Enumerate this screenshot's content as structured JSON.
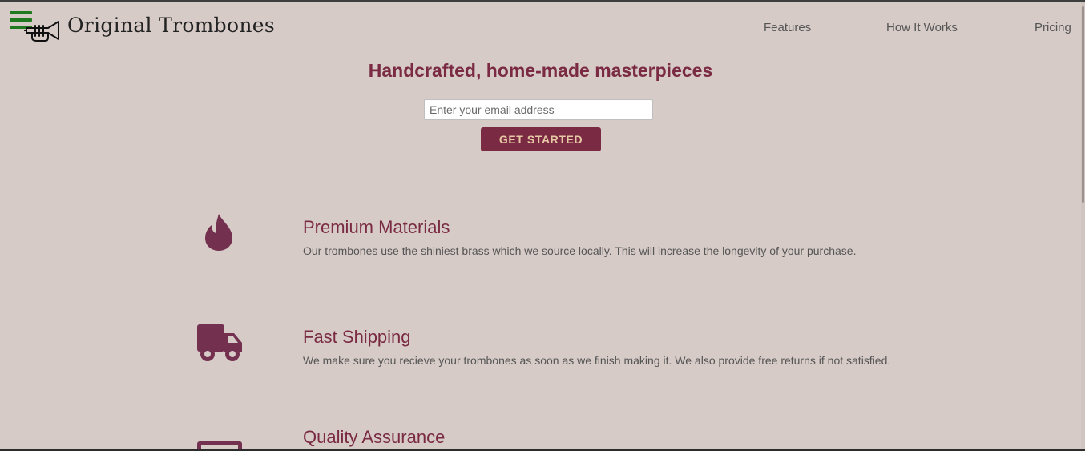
{
  "header": {
    "brand": "Original Trombones",
    "nav": [
      {
        "label": "Features"
      },
      {
        "label": "How It Works"
      },
      {
        "label": "Pricing"
      }
    ]
  },
  "hero": {
    "title": "Handcrafted, home-made masterpieces",
    "email_placeholder": "Enter your email address",
    "cta_label": "GET STARTED"
  },
  "features": [
    {
      "icon": "fire-icon",
      "title": "Premium Materials",
      "description": "Our trombones use the shiniest brass which we source locally. This will increase the longevity of your purchase."
    },
    {
      "icon": "truck-icon",
      "title": "Fast Shipping",
      "description": "We make sure you recieve your trombones as soon as we finish making it. We also provide free returns if not satisfied."
    },
    {
      "icon": "battery-icon",
      "title": "Quality Assurance",
      "description": ""
    }
  ],
  "colors": {
    "background": "#d6cbc7",
    "accent": "#7a2a42",
    "icon": "#73304f",
    "button_text": "#e8c9a6",
    "hamburger": "#1f7a1f"
  }
}
